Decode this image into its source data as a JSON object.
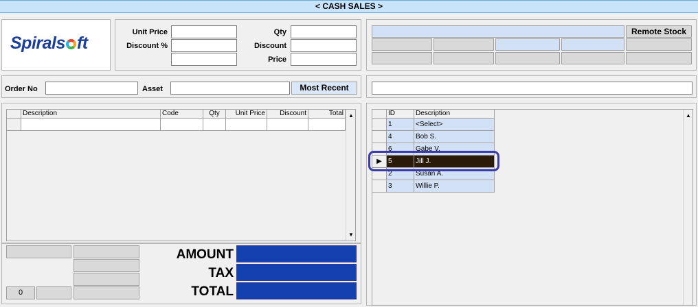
{
  "window": {
    "title": "< CASH SALES >"
  },
  "logo": {
    "text_a": "Spirals",
    "text_b": "ft"
  },
  "entry": {
    "unit_price_label": "Unit Price",
    "discount_pct_label": "Discount %",
    "qty_label": "Qty",
    "discount_label": "Discount",
    "price_label": "Price",
    "unit_price_value": "",
    "discount_pct_value": "",
    "extra_value": "",
    "qty_value": "",
    "discount_value": "",
    "price_value": ""
  },
  "order": {
    "order_no_label": "Order No",
    "order_no_value": "",
    "asset_label": "Asset",
    "asset_value": "",
    "most_recent_label": "Most Recent"
  },
  "stock": {
    "remote_stock_label": "Remote Stock",
    "search_value": "",
    "right_field_value": ""
  },
  "items_grid": {
    "columns": [
      "Description",
      "Code",
      "Qty",
      "Unit Price",
      "Discount",
      "Total"
    ],
    "rows": [
      [
        "",
        "",
        "",
        "",
        "",
        ""
      ]
    ]
  },
  "totals": {
    "counter_value": "0",
    "amount_label": "AMOUNT",
    "tax_label": "TAX",
    "total_label": "TOTAL",
    "amount_value": "",
    "tax_value": "",
    "total_value": ""
  },
  "staff_grid": {
    "columns": [
      "ID",
      "Description"
    ],
    "rows": [
      {
        "id": "1",
        "name": "<Select>"
      },
      {
        "id": "4",
        "name": "Bob S."
      },
      {
        "id": "6",
        "name": "Gabe V."
      },
      {
        "id": "5",
        "name": "Jill J.",
        "selected": true
      },
      {
        "id": "2",
        "name": "Susan A."
      },
      {
        "id": "3",
        "name": "Willie P."
      }
    ]
  },
  "colors": {
    "accent_blue": "#1441b0",
    "row_blue": "#d3e1f7",
    "selected_row": "#2a1a0a",
    "highlight_ring": "#3a3aa8"
  },
  "icons": {
    "row_pointer": "row-pointer-icon",
    "scroll_up": "scroll-up-icon",
    "scroll_down": "scroll-down-icon"
  }
}
